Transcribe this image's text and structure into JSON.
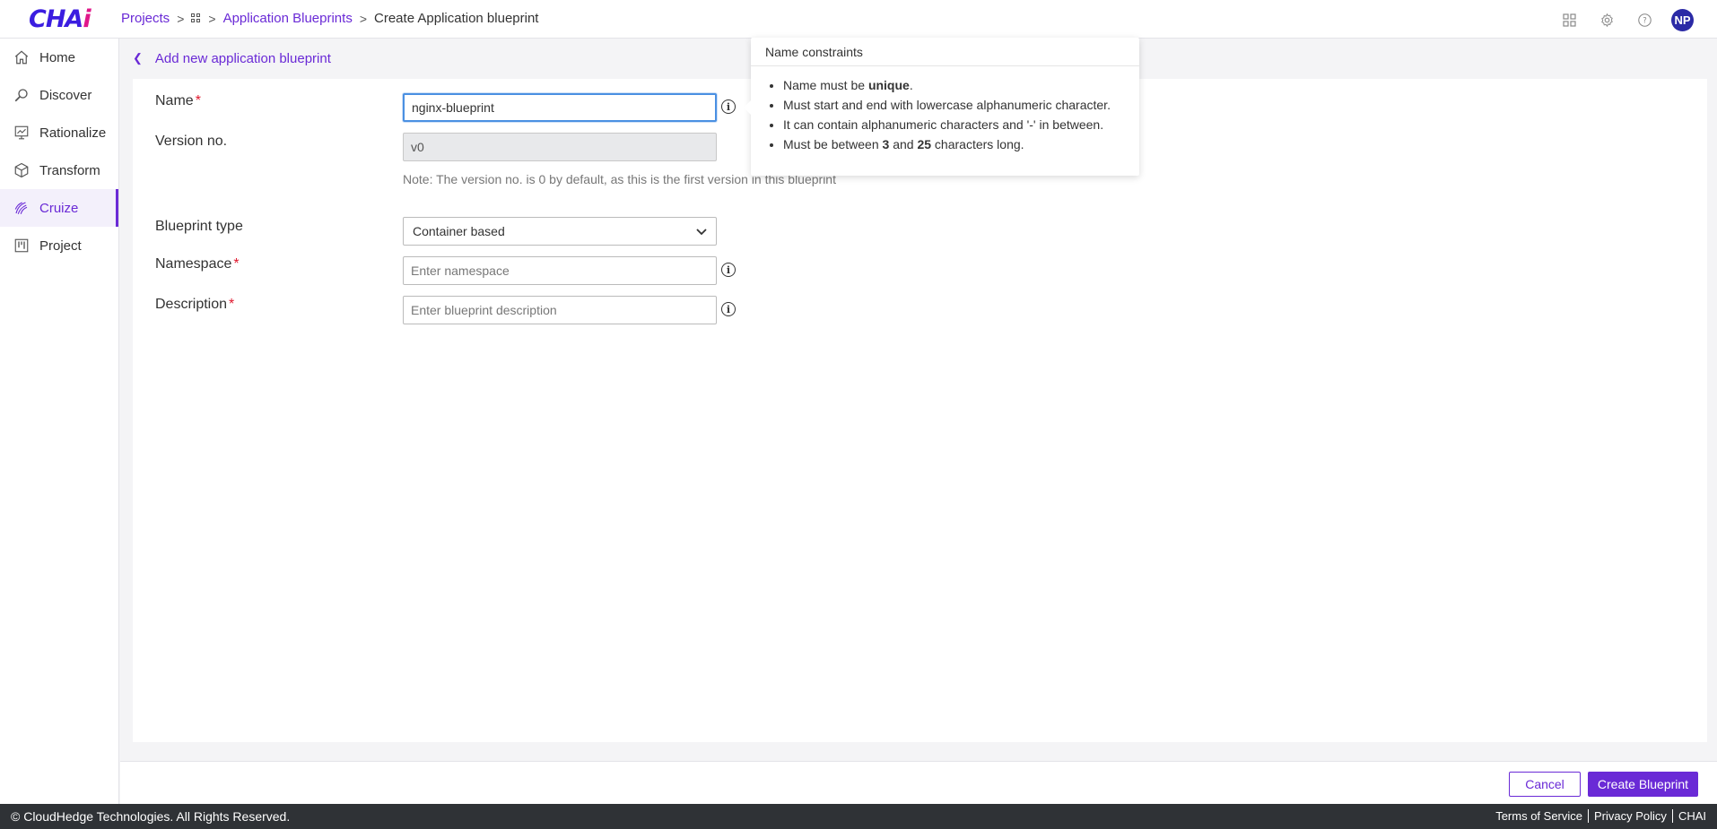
{
  "header": {
    "logo_prefix": "CHA",
    "logo_suffix": "i",
    "breadcrumb": [
      "Projects",
      "Application Blueprints",
      "Create Application blueprint"
    ],
    "avatar_initials": "NP",
    "icons": [
      "apps-grid-icon",
      "gear-icon",
      "help-icon"
    ]
  },
  "sidebar": {
    "items": [
      {
        "label": "Home",
        "icon": "home-icon"
      },
      {
        "label": "Discover",
        "icon": "discover-icon"
      },
      {
        "label": "Rationalize",
        "icon": "rationalize-icon"
      },
      {
        "label": "Transform",
        "icon": "cube-icon"
      },
      {
        "label": "Cruize",
        "icon": "cruize-icon",
        "active": true
      },
      {
        "label": "Project",
        "icon": "kanban-icon"
      }
    ]
  },
  "subheader": {
    "back_label": "Add new application blueprint"
  },
  "form": {
    "name_label": "Name",
    "name_value": "nginx-blueprint",
    "version_label": "Version no.",
    "version_value": "v0",
    "version_note": "Note: The version no. is 0 by default, as this is the first version in this blueprint",
    "type_label": "Blueprint type",
    "type_value": "Container based",
    "namespace_label": "Namespace",
    "namespace_placeholder": "Enter namespace",
    "description_label": "Description",
    "description_placeholder": "Enter blueprint description",
    "required_mark": "*"
  },
  "tooltip": {
    "title": "Name constraints",
    "rule1_a": "Name must be ",
    "rule1_b": "unique",
    "rule1_c": ".",
    "rule2": "Must start and end with lowercase alphanumeric character.",
    "rule3": "It can contain alphanumeric characters and '-' in between.",
    "rule4_a": "Must be between ",
    "rule4_b": "3",
    "rule4_c": " and ",
    "rule4_d": "25",
    "rule4_e": " characters long."
  },
  "actions": {
    "cancel_label": "Cancel",
    "create_label": "Create Blueprint"
  },
  "footer": {
    "copyright": "© CloudHedge Technologies. All Rights Reserved.",
    "terms": "Terms of Service",
    "privacy": "Privacy Policy",
    "brand": "CHAI"
  },
  "colors": {
    "accent": "#6a2ad6",
    "logo_blue": "#3b1de0",
    "logo_pink": "#e0178a",
    "required": "#e0182d",
    "footer_bg": "#2f3236"
  }
}
